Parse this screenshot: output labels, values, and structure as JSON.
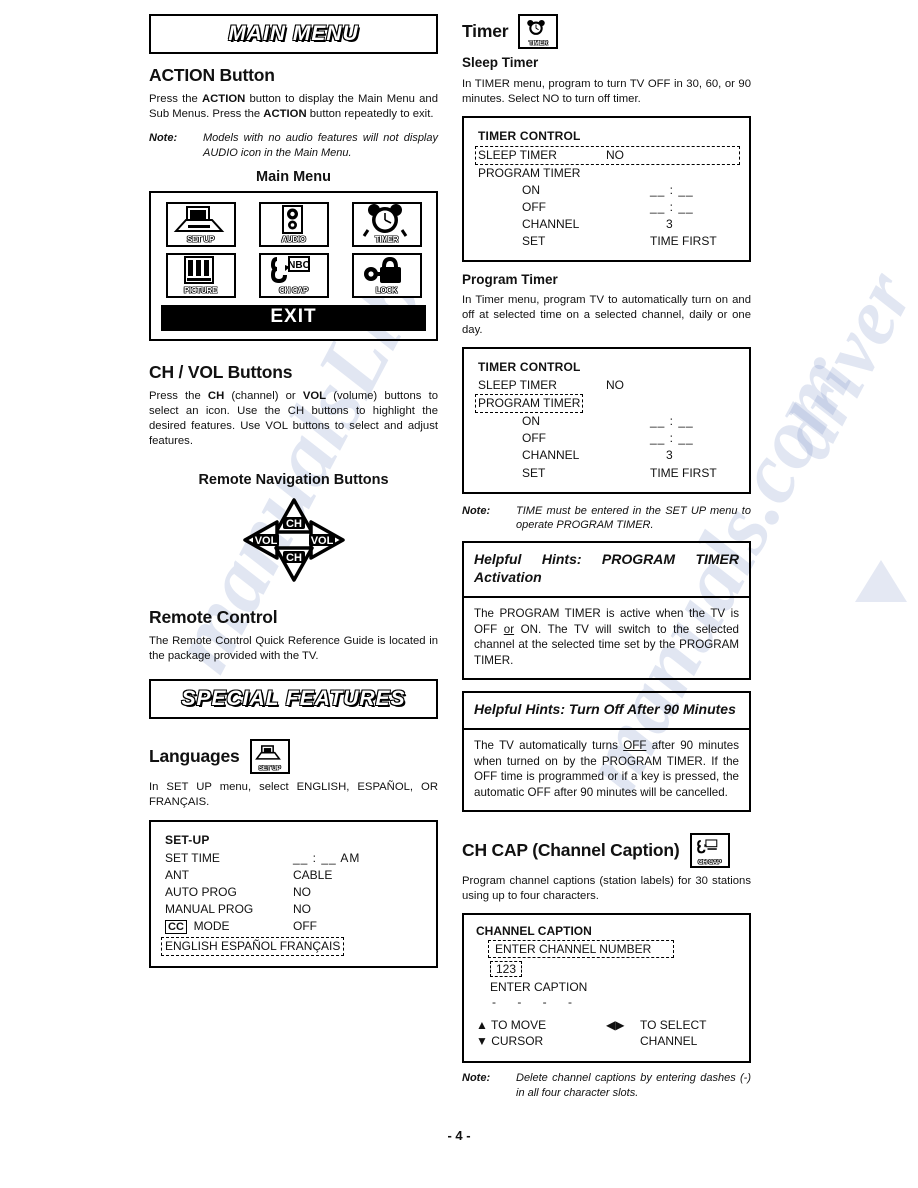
{
  "page": {
    "number": "- 4 -"
  },
  "watermark": {
    "lines": [
      "manualsLib",
      "manuals.com",
      "driver"
    ]
  },
  "left": {
    "banner_main_menu": "MAIN MENU",
    "action": {
      "heading": "ACTION Button",
      "body_1": "Press the ",
      "body_b1": "ACTION",
      "body_2": " button to display the Main Menu and Sub Menus.  Press the ",
      "body_b2": "ACTION",
      "body_3": " button repeatedly to exit.",
      "note_label": "Note:",
      "note_text": "Models with no audio features will not display AUDIO icon in the Main Menu."
    },
    "main_menu": {
      "title": "Main Menu",
      "icons": [
        {
          "label": "SET UP",
          "icon": "setup-icon"
        },
        {
          "label": "AUDIO",
          "icon": "audio-icon"
        },
        {
          "label": "TIMER",
          "icon": "timer-icon"
        },
        {
          "label": "PICTURE",
          "icon": "picture-icon"
        },
        {
          "label": "CH CAP",
          "icon": "chcap-icon"
        },
        {
          "label": "LOCK",
          "icon": "lock-icon"
        }
      ],
      "exit_label": "EXIT"
    },
    "chvol": {
      "heading": "CH / VOL Buttons",
      "body_1": "Press the ",
      "body_b1": "CH",
      "body_2": " (channel) or ",
      "body_b2": "VOL",
      "body_3": " (volume) buttons to select an icon.  Use the CH buttons to highlight the desired features.  Use VOL buttons to select and adjust features.",
      "nav_title": "Remote Navigation Buttons",
      "nav_buttons": {
        "up": "CH",
        "left": "VOL",
        "right": "VOL",
        "down": "CH"
      }
    },
    "remote": {
      "heading": "Remote Control",
      "body": "The Remote Control Quick Reference Guide is located in the package provided with the TV."
    },
    "banner_special_features": "SPECIAL FEATURES",
    "languages": {
      "heading": "Languages",
      "icon_label": "SET UP",
      "body": "In SET UP menu, select ENGLISH, ESPAÑOL, OR FRANÇAIS.",
      "osd": {
        "title": "SET-UP",
        "rows": [
          {
            "label": "SET TIME",
            "value": "__ : __   AM"
          },
          {
            "label": "ANT",
            "value": "CABLE"
          },
          {
            "label": "AUTO PROG",
            "value": "NO"
          },
          {
            "label": "MANUAL PROG",
            "value": "NO"
          }
        ],
        "cc_tag": "CC",
        "cc_label": "MODE",
        "cc_value": "OFF",
        "lang_options": "ENGLISH  ESPAÑOL  FRANÇAIS"
      }
    }
  },
  "right": {
    "timer": {
      "heading": "Timer",
      "icon_label": "TIMER",
      "sleep_heading": "Sleep Timer",
      "sleep_body": "In TIMER menu, program to turn TV OFF in 30, 60, or 90 minutes.  Select NO to turn off timer.",
      "osd_sleep": {
        "title": "TIMER CONTROL",
        "highlight_label": "SLEEP TIMER",
        "highlight_value": "NO",
        "rows": [
          {
            "label": "PROGRAM TIMER",
            "value": ""
          },
          {
            "label": "ON",
            "value": "__ : __",
            "indent": true
          },
          {
            "label": "OFF",
            "value": "__ : __",
            "indent": true
          },
          {
            "label": "CHANNEL",
            "value": "3",
            "indent": true
          },
          {
            "label": "SET",
            "value": "TIME FIRST",
            "indent": true
          }
        ]
      },
      "program_heading": "Program Timer",
      "program_body": "In Timer menu, program TV to automatically turn on and off at selected time on a selected channel, daily or one day.",
      "osd_program": {
        "title": "TIMER CONTROL",
        "row_sleep_label": "SLEEP TIMER",
        "row_sleep_value": "NO",
        "highlight_label": "PROGRAM TIMER",
        "rows": [
          {
            "label": "ON",
            "value": "__ : __",
            "indent": true
          },
          {
            "label": "OFF",
            "value": "__ : __",
            "indent": true
          },
          {
            "label": "CHANNEL",
            "value": "3",
            "indent": true
          },
          {
            "label": "SET",
            "value": "TIME FIRST",
            "indent": true
          }
        ]
      },
      "note_label": "Note:",
      "note_text": "TIME must be entered in the SET UP menu to operate PROGRAM TIMER."
    },
    "hints_1": {
      "head": "Helpful Hints:  PROGRAM TIMER Activation",
      "body_a": "The PROGRAM TIMER is active when the TV is OFF ",
      "body_u": "or",
      "body_b": " ON.  The TV will switch to the selected channel at the selected time set by the PROGRAM TIMER."
    },
    "hints_2": {
      "head": "Helpful Hints:  Turn Off After 90 Minutes",
      "body_a": "The TV automatically turns ",
      "body_u": "OFF",
      "body_b": " after 90 minutes when turned on by the PROGRAM TIMER.  If the OFF time is programmed or if a key is pressed, the automatic OFF after 90 minutes will be cancelled."
    },
    "chcap": {
      "heading": "CH CAP (Channel Caption)",
      "icon_label": "CH CAP",
      "body": "Program channel captions (station labels) for 30 stations using up to four characters.",
      "osd": {
        "title": "CHANNEL CAPTION",
        "field_label": "ENTER CHANNEL NUMBER",
        "channel_value": "123",
        "caption_label": "ENTER CAPTION",
        "caption_slots": "- - - -",
        "legend": [
          {
            "left": "▲ TO MOVE",
            "right": "TO SELECT"
          },
          {
            "left": "▼ CURSOR",
            "right": "CHANNEL"
          }
        ],
        "legend_arrows": "◀▶"
      },
      "note_label": "Note:",
      "note_text": "Delete channel captions by entering dashes (-)  in all four character slots."
    }
  }
}
